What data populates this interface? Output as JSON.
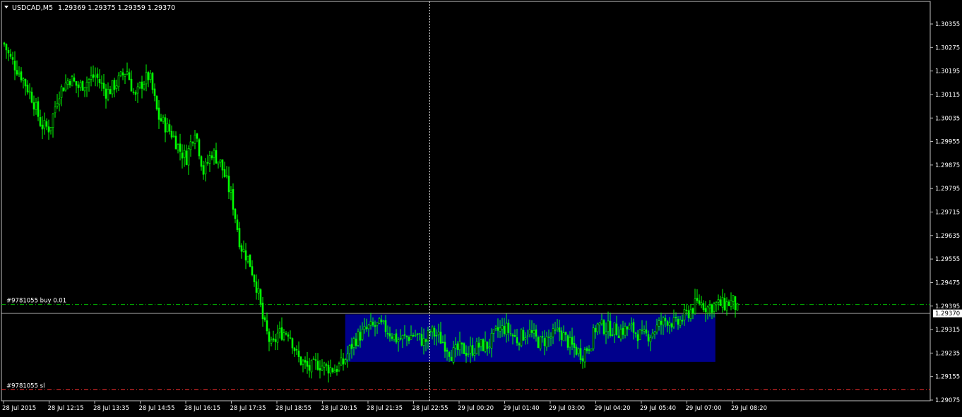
{
  "window": {
    "symbol_label": "USDCAD,M5",
    "ohlc_readout": "1.29369 1.29375 1.29359 1.29370"
  },
  "colors": {
    "background": "#000000",
    "frame": "#c0c0c0",
    "candle": "#00ff00",
    "crosshair": "#ffffff",
    "rectangle": "#00008b",
    "trade_line": "#00b400",
    "sl_line": "#ff3030",
    "bid_line": "#c0c0c0",
    "text": "#ffffff"
  },
  "chart_data": {
    "type": "candlestick",
    "ylim": [
      1.2907,
      1.3039
    ],
    "y_ticks": [
      "1.30355",
      "1.30275",
      "1.30195",
      "1.30115",
      "1.30035",
      "1.29955",
      "1.29875",
      "1.29795",
      "1.29715",
      "1.29635",
      "1.29555",
      "1.29475",
      "1.29395",
      "1.29315",
      "1.29235",
      "1.29155",
      "1.29075"
    ],
    "x_ticks": [
      "28 Jul 2015",
      "28 Jul 12:15",
      "28 Jul 13:35",
      "28 Jul 14:55",
      "28 Jul 16:15",
      "28 Jul 17:35",
      "28 Jul 18:55",
      "28 Jul 20:15",
      "28 Jul 21:35",
      "28 Jul 22:55",
      "29 Jul 00:20",
      "29 Jul 01:40",
      "29 Jul 03:00",
      "29 Jul 04:20",
      "29 Jul 05:40",
      "29 Jul 07:00",
      "29 Jul 08:20"
    ],
    "current_price": "1.29370",
    "trade_lines": [
      {
        "label": "#9781055 buy 0.01",
        "price": 1.294,
        "kind": "entry"
      },
      {
        "label": "#9781055 sl",
        "price": 1.2911,
        "kind": "stop"
      }
    ],
    "rectangle": {
      "from": "28 Jul 20:55",
      "to": "29 Jul 07:50",
      "price_high": 1.29367,
      "price_low": 1.29205
    },
    "crosshair_time": "28 Jul 23:25",
    "close_path": [
      [
        "28 Jul 2015",
        1.3029
      ],
      [
        "28 Jul 10:50",
        1.3031
      ],
      [
        "28 Jul 11:05",
        1.3024
      ],
      [
        "28 Jul 11:25",
        1.3018
      ],
      [
        "28 Jul 11:45",
        1.301
      ],
      [
        "28 Jul 12:00",
        1.3001
      ],
      [
        "28 Jul 12:15",
        1.3
      ],
      [
        "28 Jul 12:30",
        1.3012
      ],
      [
        "28 Jul 12:50",
        1.3017
      ],
      [
        "28 Jul 13:05",
        1.3014
      ],
      [
        "28 Jul 13:35",
        1.3018
      ],
      [
        "28 Jul 13:55",
        1.3012
      ],
      [
        "28 Jul 14:15",
        1.3016
      ],
      [
        "28 Jul 14:30",
        1.302
      ],
      [
        "28 Jul 14:45",
        1.301
      ],
      [
        "28 Jul 14:55",
        1.3015
      ],
      [
        "28 Jul 15:10",
        1.3018
      ],
      [
        "28 Jul 15:25",
        1.3004
      ],
      [
        "28 Jul 15:50",
        1.2998
      ],
      [
        "28 Jul 16:05",
        1.2992
      ],
      [
        "28 Jul 16:15",
        1.299
      ],
      [
        "28 Jul 16:30",
        1.3
      ],
      [
        "28 Jul 16:45",
        1.2985
      ],
      [
        "28 Jul 17:00",
        1.2992
      ],
      [
        "28 Jul 17:15",
        1.2988
      ],
      [
        "28 Jul 17:35",
        1.2976
      ],
      [
        "28 Jul 17:50",
        1.296
      ],
      [
        "28 Jul 18:05",
        1.2955
      ],
      [
        "28 Jul 18:20",
        1.2945
      ],
      [
        "28 Jul 18:30",
        1.2934
      ],
      [
        "28 Jul 18:45",
        1.2925
      ],
      [
        "28 Jul 18:55",
        1.293
      ],
      [
        "28 Jul 19:15",
        1.2931
      ],
      [
        "28 Jul 19:30",
        1.2922
      ],
      [
        "28 Jul 19:50",
        1.2918
      ],
      [
        "28 Jul 20:05",
        1.292
      ],
      [
        "28 Jul 20:15",
        1.2919
      ],
      [
        "28 Jul 20:35",
        1.2918
      ],
      [
        "28 Jul 20:50",
        1.292
      ],
      [
        "28 Jul 21:10",
        1.2928
      ],
      [
        "28 Jul 21:35",
        1.2932
      ],
      [
        "28 Jul 21:55",
        1.2933
      ],
      [
        "28 Jul 22:10",
        1.2931
      ],
      [
        "28 Jul 22:25",
        1.2928
      ],
      [
        "28 Jul 22:45",
        1.2929
      ],
      [
        "28 Jul 22:55",
        1.293
      ],
      [
        "28 Jul 23:15",
        1.2927
      ],
      [
        "28 Jul 23:25",
        1.2931
      ],
      [
        "28 Jul 23:40",
        1.2929
      ],
      [
        "28 Jul 23:55",
        1.2926
      ],
      [
        "29 Jul 00:05",
        1.2923
      ],
      [
        "29 Jul 00:20",
        1.2925
      ],
      [
        "29 Jul 00:35",
        1.2924
      ],
      [
        "29 Jul 00:55",
        1.2926
      ],
      [
        "29 Jul 01:10",
        1.2926
      ],
      [
        "29 Jul 01:25",
        1.2931
      ],
      [
        "29 Jul 01:40",
        1.2932
      ],
      [
        "29 Jul 02:00",
        1.2928
      ],
      [
        "29 Jul 02:20",
        1.2931
      ],
      [
        "29 Jul 02:40",
        1.2927
      ],
      [
        "29 Jul 03:00",
        1.2929
      ],
      [
        "29 Jul 03:15",
        1.2931
      ],
      [
        "29 Jul 03:35",
        1.2926
      ],
      [
        "29 Jul 03:55",
        1.2923
      ],
      [
        "29 Jul 04:10",
        1.2927
      ],
      [
        "29 Jul 04:20",
        1.2933
      ],
      [
        "29 Jul 04:40",
        1.2932
      ],
      [
        "29 Jul 05:00",
        1.2931
      ],
      [
        "29 Jul 05:20",
        1.2932
      ],
      [
        "29 Jul 05:40",
        1.2929
      ],
      [
        "29 Jul 05:55",
        1.293
      ],
      [
        "29 Jul 06:10",
        1.2933
      ],
      [
        "29 Jul 06:25",
        1.2935
      ],
      [
        "29 Jul 06:40",
        1.2933
      ],
      [
        "29 Jul 07:00",
        1.2937
      ],
      [
        "29 Jul 07:20",
        1.2941
      ],
      [
        "29 Jul 07:35",
        1.2939
      ],
      [
        "29 Jul 07:50",
        1.294
      ],
      [
        "29 Jul 08:05",
        1.294
      ],
      [
        "29 Jul 08:20",
        1.2941
      ],
      [
        "29 Jul 08:30",
        1.2937
      ]
    ]
  }
}
